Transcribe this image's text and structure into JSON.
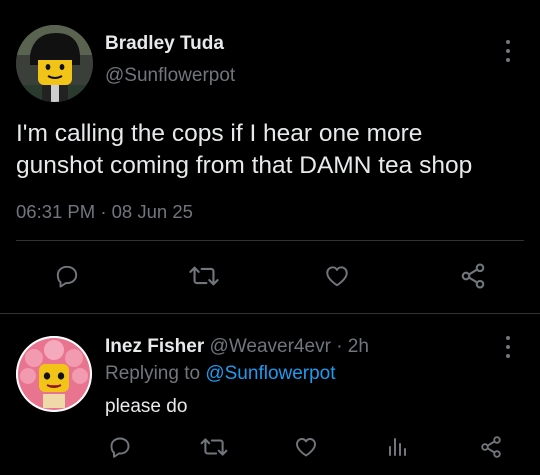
{
  "tweet": {
    "author_name": "Bradley Tuda",
    "author_handle": "@Sunflowerpot",
    "text": "I'm calling the cops if I hear one more\ngunshot coming from that DAMN tea shop",
    "time": "06:31 PM",
    "separator": "·",
    "date": "08 Jun 25",
    "actions": [
      "reply-icon",
      "retweet-icon",
      "like-icon",
      "share-icon"
    ]
  },
  "reply": {
    "author_name": "Inez Fisher",
    "author_handle": "@Weaver4evr",
    "separator": "·",
    "age": "2h",
    "replying_prefix": "Replying to",
    "replying_to": "@Sunflowerpot",
    "text": "please do",
    "actions": [
      "reply-icon",
      "retweet-icon",
      "like-icon",
      "views-icon",
      "share-icon"
    ]
  },
  "colors": {
    "background": "#000000",
    "text": "#e7e9ea",
    "muted": "#71767b",
    "accent": "#1d9bf0",
    "divider": "#2f3336"
  }
}
